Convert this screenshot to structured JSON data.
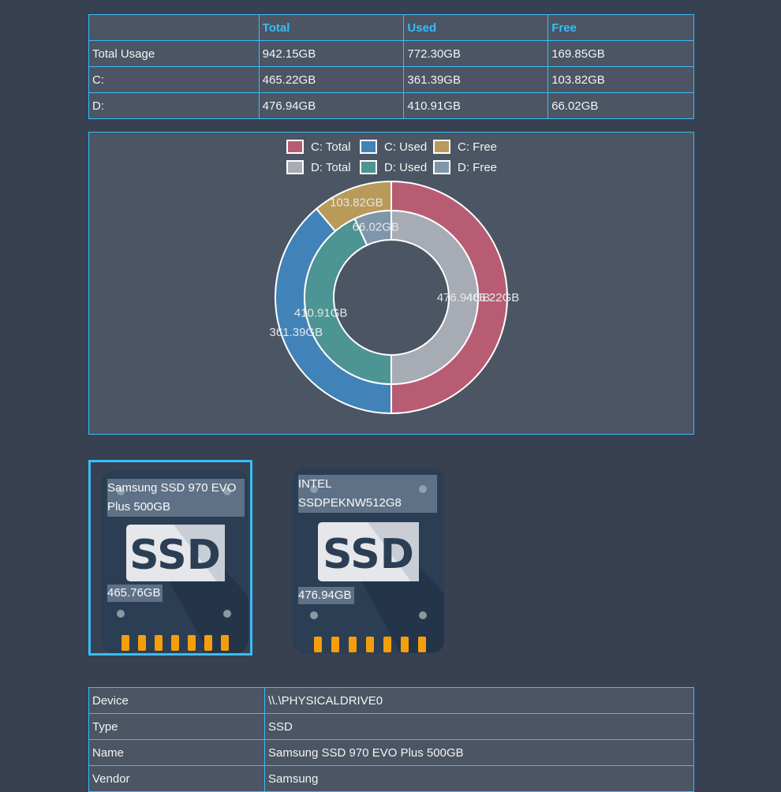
{
  "usage_table": {
    "headers": [
      "",
      "Total",
      "Used",
      "Free"
    ],
    "rows": [
      [
        "Total Usage",
        "942.15GB",
        "772.30GB",
        "169.85GB"
      ],
      [
        "C:",
        "465.22GB",
        "361.39GB",
        "103.82GB"
      ],
      [
        "D:",
        "476.94GB",
        "410.91GB",
        "66.02GB"
      ]
    ]
  },
  "chart_data": {
    "type": "pie",
    "legend": [
      {
        "label": "C: Total",
        "color": "#b85c74"
      },
      {
        "label": "C: Used",
        "color": "#4183b8"
      },
      {
        "label": "C: Free",
        "color": "#b99a58"
      },
      {
        "label": "D: Total",
        "color": "#a7abb4"
      },
      {
        "label": "D: Used",
        "color": "#4d9494"
      },
      {
        "label": "D: Free",
        "color": "#7f95aa"
      }
    ],
    "rings": [
      {
        "name": "outer",
        "slices": [
          {
            "label": "465.22GB",
            "value": 465.22,
            "color": "#b85c74"
          },
          {
            "label": "361.39GB",
            "value": 361.39,
            "color": "#4183b8"
          },
          {
            "label": "103.82GB",
            "value": 103.82,
            "color": "#b99a58"
          }
        ]
      },
      {
        "name": "inner",
        "slices": [
          {
            "label": "476.94GB",
            "value": 476.94,
            "color": "#a7abb4"
          },
          {
            "label": "410.91GB",
            "value": 410.91,
            "color": "#4d9494"
          },
          {
            "label": "66.02GB",
            "value": 66.02,
            "color": "#7f95aa"
          }
        ]
      }
    ]
  },
  "drives": [
    {
      "name": "Samsung SSD 970 EVO Plus 500GB",
      "size": "465.76GB",
      "badge": "SSD",
      "selected": true
    },
    {
      "name": "INTEL SSDPEKNW512G8",
      "size": "476.94GB",
      "badge": "SSD",
      "selected": false
    }
  ],
  "drive_icon": "ssd-icon",
  "details": [
    [
      "Device",
      "\\\\.\\PHYSICALDRIVE0"
    ],
    [
      "Type",
      "SSD"
    ],
    [
      "Name",
      "Samsung SSD 970 EVO Plus 500GB"
    ],
    [
      "Vendor",
      "Samsung"
    ]
  ]
}
